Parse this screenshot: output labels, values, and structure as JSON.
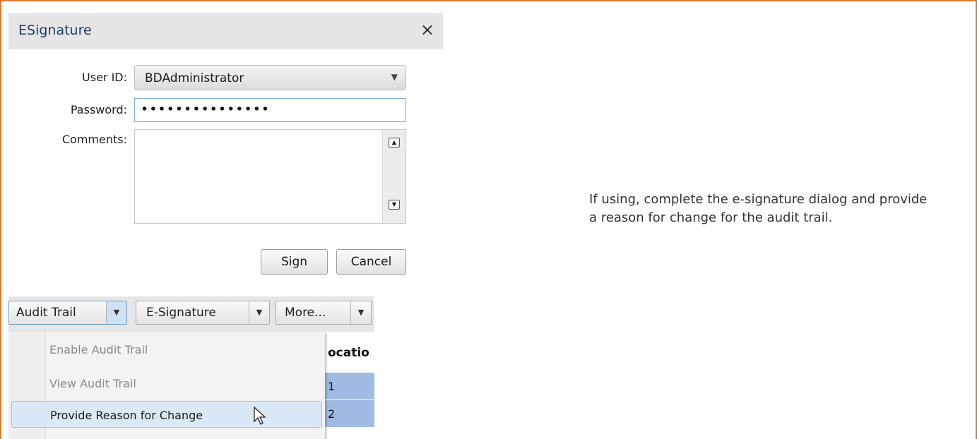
{
  "dialog": {
    "title": "ESignature",
    "close_glyph": "×",
    "user_id_label": "User ID:",
    "user_id_value": "BDAdministrator",
    "password_label": "Password:",
    "password_mask": "•••••••••••••••",
    "comments_label": "Comments:",
    "comments_value": "",
    "sign_label": "Sign",
    "cancel_label": "Cancel"
  },
  "toolbar": {
    "buttons": [
      {
        "label": "Audit Trail",
        "dropdown_glyph": "▼"
      },
      {
        "label": "E-Signature",
        "dropdown_glyph": "▼"
      },
      {
        "label": "More...",
        "dropdown_glyph": "▼"
      }
    ]
  },
  "menu": {
    "items": [
      {
        "label": "Enable Audit Trail",
        "enabled": false
      },
      {
        "label": "View Audit Trail",
        "enabled": false
      },
      {
        "label": "Provide Reason for Change",
        "enabled": true,
        "hovered": true
      }
    ]
  },
  "grid": {
    "column_header": "ocatio",
    "rows": [
      "1",
      "2"
    ]
  },
  "instruction": {
    "text": "If using, complete the e-signature dialog and provide a reason for change for the audit trail."
  },
  "colors": {
    "frame_border": "#e07a2c",
    "title_text": "#1f3d64",
    "grid_row_fill": "#9fbbe4",
    "menu_hover": "#dbe9f6"
  }
}
